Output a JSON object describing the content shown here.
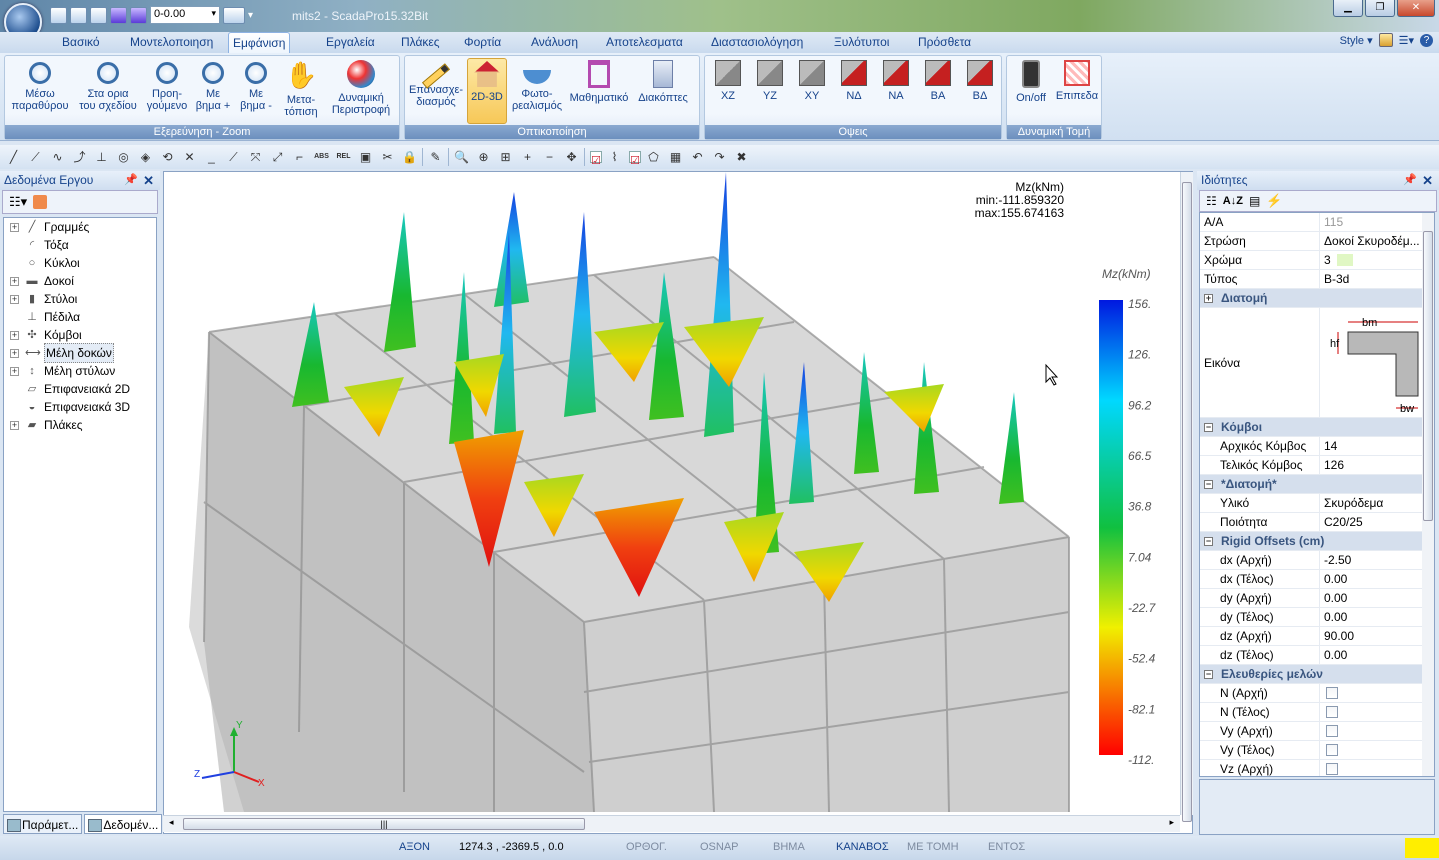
{
  "window": {
    "title": "mits2 - ScadaPro15.32Bit",
    "layer_value": "0-0.00",
    "style_label": "Style"
  },
  "tabs": [
    "Βασικό",
    "Μοντελοποιηση",
    "Εμφάνιση",
    "Εργαλεία",
    "Πλάκες",
    "Φορτία",
    "Ανάλυση",
    "Αποτελεσματα",
    "Διαστασιολόγηση",
    "Ξυλότυποι",
    "Πρόσθετα"
  ],
  "active_tab": "Εμφάνιση",
  "ribbon": {
    "zoom": {
      "title": "Εξερεύνηση - Zoom",
      "buttons": [
        {
          "label1": "Μέσω",
          "label2": "παραθύρου",
          "icon": "zoom-window-icon"
        },
        {
          "label1": "Στα ορια",
          "label2": "του σχεδίου",
          "icon": "zoom-extents-icon"
        },
        {
          "label1": "Προη-",
          "label2": "γούμενο",
          "icon": "zoom-previous-icon"
        },
        {
          "label1": "Με",
          "label2": "βημα +",
          "icon": "zoom-in-icon"
        },
        {
          "label1": "Με",
          "label2": "βημα -",
          "icon": "zoom-out-icon"
        },
        {
          "label1": "Μετα-",
          "label2": "τόπιση",
          "icon": "pan-hand-icon"
        },
        {
          "label1": "Δυναμική",
          "label2": "Περιστροφή",
          "icon": "orbit-globe-icon"
        }
      ]
    },
    "view": {
      "title": "Οπτικοποίηση",
      "buttons": [
        {
          "label1": "Επανασχε-",
          "label2": "διασμός",
          "icon": "redraw-pencil-icon"
        },
        {
          "label1": "2D-3D",
          "label2": "",
          "icon": "house-3d-icon"
        },
        {
          "label1": "Φωτο-",
          "label2": "ρεαλισμός",
          "icon": "photorealism-icon"
        },
        {
          "label1": "Μαθηματικό",
          "label2": "",
          "icon": "math-model-icon"
        },
        {
          "label1": "Διακόπτες",
          "label2": "",
          "icon": "switches-icon"
        }
      ]
    },
    "views": {
      "title": "Οψεις",
      "buttons": [
        "XZ",
        "YZ",
        "XY",
        "ΝΔ",
        "ΝΑ",
        "ΒΑ",
        "ΒΔ"
      ]
    },
    "section": {
      "title": "Δυναμική Τομή",
      "buttons": [
        "On/off",
        "Επιπεδα"
      ]
    }
  },
  "toolbar_icons": [
    "line",
    "polyline",
    "spline",
    "curve",
    "perpendicular",
    "circle",
    "diamond",
    "rotate",
    "cross",
    "underscore",
    "pencil-line",
    "mirror",
    "scale",
    "snap-corner",
    "ABS",
    "REL",
    "frame",
    "cut",
    "lock",
    "sep",
    "pen",
    "sep",
    "zoom",
    "zoom-plus",
    "zoom-window",
    "zoom-in",
    "zoom-out",
    "pan",
    "sep",
    "check",
    "chart",
    "check2",
    "polygon",
    "grid",
    "undo",
    "redo",
    "close"
  ],
  "left_panel": {
    "title": "Δεδομένα Εργου",
    "tree": [
      {
        "label": "Γραμμές",
        "icon": "line-icon",
        "expand": true
      },
      {
        "label": "Τόξα",
        "icon": "arc-icon",
        "expand": false
      },
      {
        "label": "Κύκλοι",
        "icon": "circle-icon",
        "expand": false
      },
      {
        "label": "Δοκοί",
        "icon": "beam-icon",
        "expand": true
      },
      {
        "label": "Στύλοι",
        "icon": "column-icon",
        "expand": true
      },
      {
        "label": "Πέδιλα",
        "icon": "footing-icon",
        "expand": false
      },
      {
        "label": "Κόμβοι",
        "icon": "node-icon",
        "expand": true
      },
      {
        "label": "Μέλη δοκών",
        "icon": "beam-member-icon",
        "expand": true,
        "highlight": true
      },
      {
        "label": "Μέλη στύλων",
        "icon": "column-member-icon",
        "expand": true
      },
      {
        "label": "Επιφανειακά 2D",
        "icon": "surface-2d-icon",
        "expand": false
      },
      {
        "label": "Επιφανειακά 3D",
        "icon": "surface-3d-icon",
        "expand": false
      },
      {
        "label": "Πλάκες",
        "icon": "slab-icon",
        "expand": true
      }
    ],
    "bottom_tabs": [
      "Παράμετ...",
      "Δεδομέν..."
    ]
  },
  "viewport": {
    "result_label": "Mz(kNm)",
    "min_text": "min:-111.859320",
    "max_text": "max:155.674163",
    "legend_title": "Mz(kNm)",
    "legend_ticks": [
      "156.",
      "126.",
      "96.2",
      "66.5",
      "36.8",
      "7.04",
      "-22.7",
      "-52.4",
      "-82.1",
      "-112."
    ],
    "axis": {
      "x": "X",
      "y": "Y",
      "z": "Z"
    }
  },
  "right_panel": {
    "title": "Ιδιότητες",
    "rows": [
      {
        "type": "row",
        "k": "Α/Α",
        "v": "115",
        "grey": true
      },
      {
        "type": "row",
        "k": "Στρώση",
        "v": "Δοκοί Σκυροδέμ..."
      },
      {
        "type": "row",
        "k": "Χρώμα",
        "v": "3",
        "color": true
      },
      {
        "type": "row",
        "k": "Τύπος",
        "v": "B-3d"
      },
      {
        "type": "cat",
        "k": "Διατομή",
        "sign": "+"
      },
      {
        "type": "image",
        "k": "Εικόνα",
        "bm": "bm",
        "hf": "hf",
        "bw": "bw"
      },
      {
        "type": "cat",
        "k": "Κόμβοι",
        "sign": "−"
      },
      {
        "type": "row",
        "k": "Αρχικός Κόμβος",
        "v": "14",
        "ind": true
      },
      {
        "type": "row",
        "k": "Τελικός Κόμβος",
        "v": "126",
        "ind": true
      },
      {
        "type": "cat",
        "k": "*Διατομή*",
        "sign": "−"
      },
      {
        "type": "row",
        "k": "Υλικό",
        "v": "Σκυρόδεμα",
        "ind": true
      },
      {
        "type": "row",
        "k": "Ποιότητα",
        "v": "C20/25",
        "ind": true
      },
      {
        "type": "cat",
        "k": "Rigid Offsets (cm)",
        "sign": "−"
      },
      {
        "type": "row",
        "k": "dx (Αρχή)",
        "v": "-2.50",
        "ind": true
      },
      {
        "type": "row",
        "k": "dx (Τέλος)",
        "v": "0.00",
        "ind": true
      },
      {
        "type": "row",
        "k": "dy (Αρχή)",
        "v": "0.00",
        "ind": true
      },
      {
        "type": "row",
        "k": "dy (Τέλος)",
        "v": "0.00",
        "ind": true
      },
      {
        "type": "row",
        "k": "dz (Αρχή)",
        "v": "90.00",
        "ind": true
      },
      {
        "type": "row",
        "k": "dz (Τέλος)",
        "v": "0.00",
        "ind": true
      },
      {
        "type": "cat",
        "k": "Ελευθερίες μελών",
        "sign": "−"
      },
      {
        "type": "row",
        "k": "N (Αρχή)",
        "check": true,
        "ind": true
      },
      {
        "type": "row",
        "k": "N (Τέλος)",
        "check": true,
        "ind": true
      },
      {
        "type": "row",
        "k": "Vy (Αρχή)",
        "check": true,
        "ind": true
      },
      {
        "type": "row",
        "k": "Vy (Τέλος)",
        "check": true,
        "ind": true
      },
      {
        "type": "row",
        "k": "Vz (Αρχή)",
        "check": true,
        "ind": true
      }
    ]
  },
  "status": {
    "axon": "ΑΞΟΝ",
    "coords": "1274.3 , -2369.5 , 0.0",
    "orthog": "ΟΡΘΟΓ.",
    "osnap": "OSNAP",
    "step": "ΒΗΜΑ",
    "grid": "ΚΑΝΑΒΟΣ",
    "cut": "ΜΕ ΤΟΜΗ",
    "inside": "ΕΝΤΟΣ"
  }
}
